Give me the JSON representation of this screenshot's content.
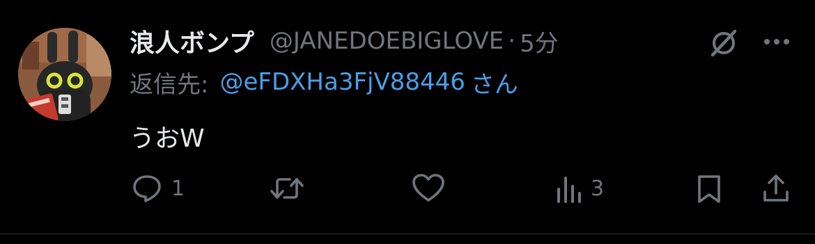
{
  "post": {
    "author": {
      "display_name": "浪人ボンプ",
      "handle": "@JANEDOEBIGLOVE"
    },
    "separator": "·",
    "time": "5分",
    "reply_to": {
      "prefix": "返信先:",
      "handle": "@eFDXHa3FjV88446",
      "suffix": "さん"
    },
    "text": "うおW",
    "actions": {
      "reply_count": "1",
      "views_count": "3"
    }
  },
  "colors": {
    "background": "#000000",
    "primary_text": "#e7e9ea",
    "secondary_text": "#71767b",
    "link": "#4a9fe8",
    "avatar_eye": "#d7e638"
  },
  "icons": {
    "top_right": [
      "grok-icon",
      "more-icon"
    ],
    "actions": [
      "reply-icon",
      "repost-icon",
      "like-icon",
      "views-icon",
      "bookmark-icon",
      "share-icon"
    ]
  }
}
